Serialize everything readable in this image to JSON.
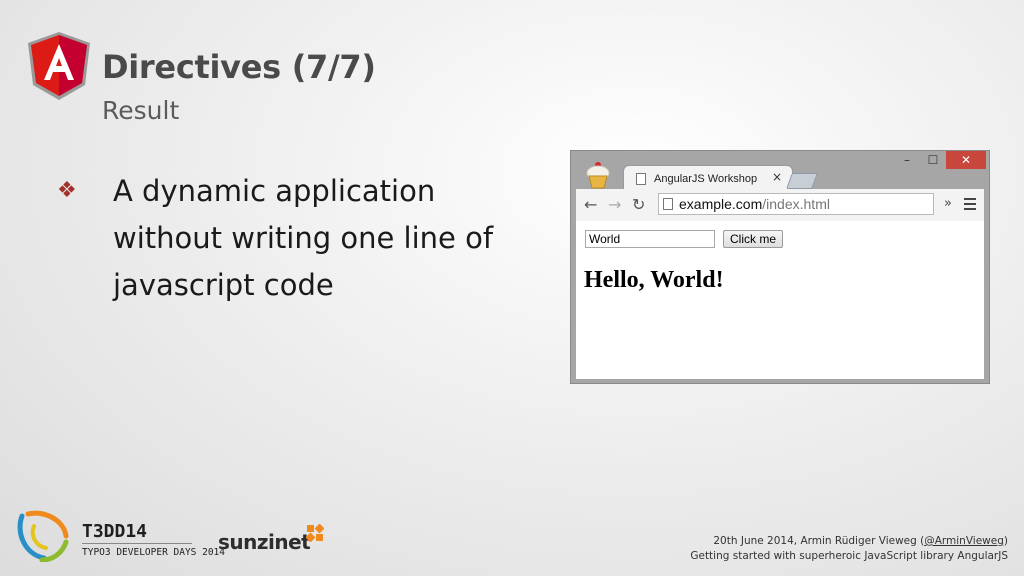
{
  "slide": {
    "title": "Directives (7/7)",
    "subtitle": "Result",
    "bullet": "A dynamic application without writing one line of javascript code"
  },
  "browser": {
    "tab_title": "AngularJS Workshop",
    "tab_close": "×",
    "window_controls": {
      "minimize": "–",
      "maximize": "☐",
      "close": "✕"
    },
    "url_host": "example.com",
    "url_path": "/index.html",
    "extensions_label": "»",
    "input_value": "World",
    "button_label": "Click me",
    "greeting": "Hello, World!"
  },
  "footer": {
    "event_name": "T3DD14",
    "event_subtitle": "TYPO3 DEVELOPER DAYS 2014",
    "sponsor": "sunzinet",
    "line1_prefix": "20th June 2014, Armin Rüdiger Vieweg (",
    "line1_handle": "@ArminVieweg",
    "line1_suffix": ")",
    "line2": "Getting started with superheroic JavaScript library AngularJS"
  },
  "colors": {
    "accent": "#a3312b",
    "angular_red": "#dd1b16",
    "close_button": "#c9463d"
  }
}
